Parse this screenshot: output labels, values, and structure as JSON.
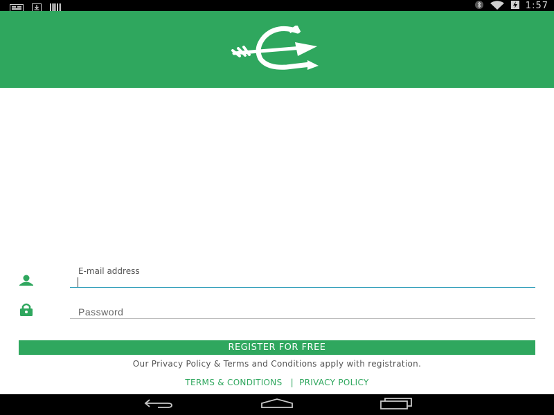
{
  "status_bar": {
    "time": "1:57",
    "left_icons": [
      "notification-icon",
      "download-icon",
      "barcode-icon"
    ],
    "right_icons": [
      "bluetooth-icon",
      "wifi-icon",
      "battery-charging-icon"
    ]
  },
  "header": {
    "logo_icon": "arrow-logo-icon",
    "background_color": "#2fa75e"
  },
  "form": {
    "email": {
      "label": "E-mail address",
      "value": "",
      "icon": "person-icon"
    },
    "password": {
      "placeholder": "Password",
      "value": "",
      "icon": "lock-icon"
    },
    "register_label": "REGISTER FOR FREE",
    "privacy_note": "Our Privacy Policy & Terms and Conditions apply with registration.",
    "terms_link": "TERMS & CONDITIONS",
    "separator": "|",
    "privacy_link": "PRIVACY POLICY"
  },
  "nav_bar": {
    "buttons": [
      "back-icon",
      "home-icon",
      "recent-apps-icon"
    ]
  },
  "colors": {
    "accent": "#2fa75e",
    "input_focus_line": "#2a9bb8",
    "input_line": "#bdbdbd"
  }
}
